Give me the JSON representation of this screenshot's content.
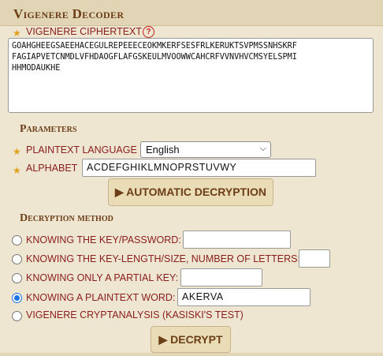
{
  "title": "Vigenere Decoder",
  "ciphertext": {
    "label": "VIGENERE CIPHERTEXT",
    "help": "?",
    "value": "GOAHGHEEGSAEEHACEGULREPEEECEOKMKERFSESFRLKERUKTSVPMSSNHSKRF\nFAGIAPVETCNMDLVFHDAOGFLAFGSKEULMVOOWWCAHCRFVVNVHVCMSYELSPMI\nHHMODAUKHE"
  },
  "parameters": {
    "heading": "Parameters",
    "language_label": "PLAINTEXT LANGUAGE",
    "language_value": "English",
    "alphabet_label": "ALPHABET",
    "alphabet_value": "ACDEFGHIKLMNOPRSTUVWY",
    "auto_button": "▶ AUTOMATIC DECRYPTION"
  },
  "method": {
    "heading": "Decryption method",
    "options": [
      {
        "label": "KNOWING THE KEY/PASSWORD:",
        "value": ""
      },
      {
        "label": "KNOWING THE KEY-LENGTH/SIZE, NUMBER OF LETTERS:",
        "value": ""
      },
      {
        "label": "KNOWING ONLY A PARTIAL KEY:",
        "value": ""
      },
      {
        "label": "KNOWING A PLAINTEXT WORD:",
        "value": "AKERVA",
        "checked": true
      },
      {
        "label": "VIGENERE CRYPTANALYSIS (KASISKI'S TEST)"
      }
    ],
    "decrypt_button": "▶ DECRYPT"
  },
  "colors": {
    "background": "#efe6d2",
    "heading": "#6b3e17",
    "label": "#8a1d1d",
    "star": "#e0a11b",
    "radio_checked": "#1a73e8"
  }
}
